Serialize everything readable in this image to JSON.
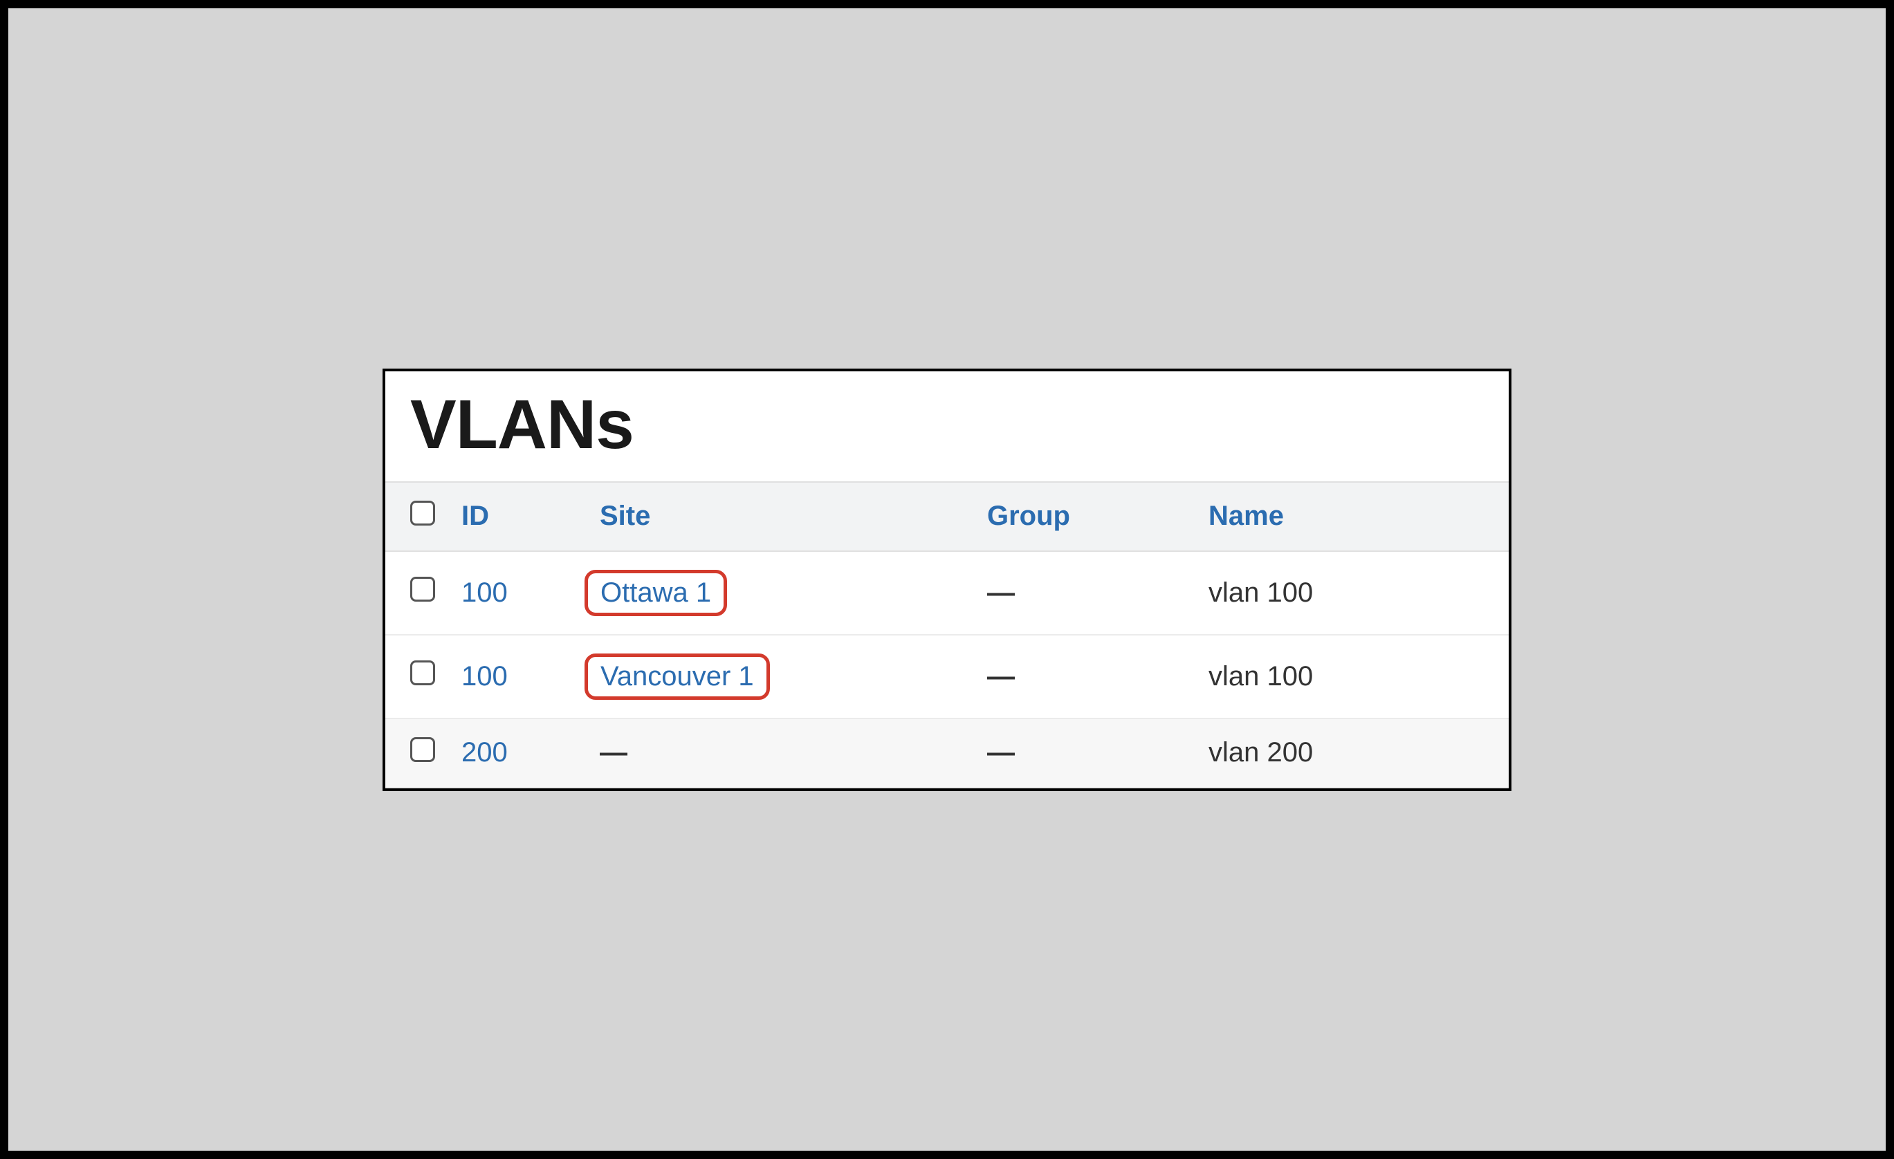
{
  "header": {
    "title": "VLANs"
  },
  "table": {
    "columns": {
      "id": "ID",
      "site": "Site",
      "group": "Group",
      "name": "Name"
    },
    "rows": [
      {
        "id": "100",
        "site": "Ottawa 1",
        "site_highlighted": true,
        "group": "—",
        "name": "vlan 100",
        "alt": false
      },
      {
        "id": "100",
        "site": "Vancouver 1",
        "site_highlighted": true,
        "group": "—",
        "name": "vlan 100",
        "alt": false
      },
      {
        "id": "200",
        "site": "—",
        "site_highlighted": false,
        "group": "—",
        "name": "vlan 200",
        "alt": true
      }
    ]
  }
}
